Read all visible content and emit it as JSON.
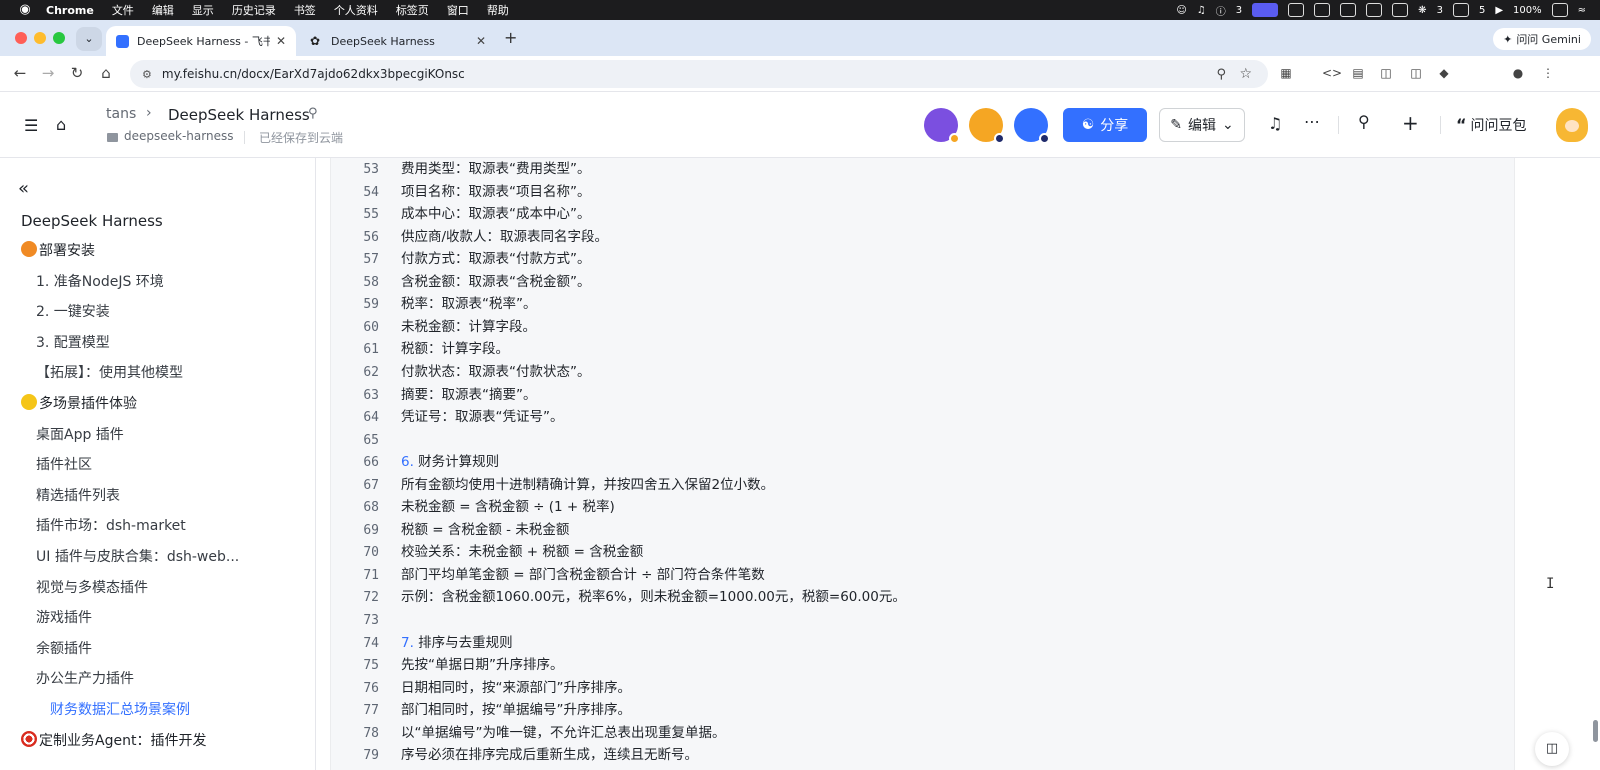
{
  "menubar": {
    "app": "Chrome",
    "items": [
      "文件",
      "编辑",
      "显示",
      "历史记录",
      "书签",
      "个人资料",
      "标签页",
      "窗口",
      "帮助"
    ],
    "status": {
      "notif_count": "3",
      "wechat_count": "3",
      "count5": "5",
      "battery": "100%"
    }
  },
  "browser": {
    "tabs": [
      {
        "title": "DeepSeek Harness - 飞书云文",
        "favicon": "feishu-doc-icon"
      },
      {
        "title": "DeepSeek Harness",
        "favicon": "deepseek-whale-icon"
      }
    ],
    "gemini_label": "问问 Gemini",
    "url": "my.feishu.cn/docx/EarXd7ajdo62dkx3bpecgiKOnsc"
  },
  "header": {
    "breadcrumb_parent": "tans",
    "breadcrumb_current": "DeepSeek Harness",
    "folder": "deepseek-harness",
    "saved_status": "已经保存到云端",
    "share_label": "分享",
    "edit_label": "编辑",
    "ask_label": "问问豆包",
    "colors": {
      "accent": "#3370ff"
    }
  },
  "sidebar": {
    "doc_title": "DeepSeek Harness",
    "items": [
      {
        "label": "部署安装",
        "level": 1,
        "emoji": "pumpkin"
      },
      {
        "label": "1. 准备NodeJS 环境",
        "level": 2
      },
      {
        "label": "2. 一键安装",
        "level": 2
      },
      {
        "label": "3. 配置模型",
        "level": 2
      },
      {
        "label": "【拓展】：使用其他模型",
        "level": 2
      },
      {
        "label": "多场景插件体验",
        "level": 1,
        "emoji": "smile"
      },
      {
        "label": "桌面App 插件",
        "level": 2
      },
      {
        "label": "插件社区",
        "level": 2
      },
      {
        "label": "精选插件列表",
        "level": 2
      },
      {
        "label": "插件市场：dsh-market",
        "level": 2
      },
      {
        "label": "UI 插件与皮肤合集：dsh-web...",
        "level": 2
      },
      {
        "label": "视觉与多模态插件",
        "level": 2
      },
      {
        "label": "游戏插件",
        "level": 2
      },
      {
        "label": "余额插件",
        "level": 2
      },
      {
        "label": "办公生产力插件",
        "level": 2
      },
      {
        "label": "财务数据汇总场景案例",
        "level": 3,
        "active": true
      },
      {
        "label": "定制业务Agent：插件开发",
        "level": 1,
        "emoji": "target"
      }
    ]
  },
  "code": {
    "lines": [
      {
        "n": "53",
        "text": "费用类型：取源表“费用类型”。"
      },
      {
        "n": "54",
        "text": "项目名称：取源表“项目名称”。"
      },
      {
        "n": "55",
        "text": "成本中心：取源表“成本中心”。"
      },
      {
        "n": "56",
        "text": "供应商/收款人：取源表同名字段。"
      },
      {
        "n": "57",
        "text": "付款方式：取源表“付款方式”。"
      },
      {
        "n": "58",
        "text": "含税金额：取源表“含税金额”。"
      },
      {
        "n": "59",
        "text": "税率：取源表“税率”。"
      },
      {
        "n": "60",
        "text": "未税金额：计算字段。"
      },
      {
        "n": "61",
        "text": "税额：计算字段。"
      },
      {
        "n": "62",
        "text": "付款状态：取源表“付款状态”。"
      },
      {
        "n": "63",
        "text": "摘要：取源表“摘要”。"
      },
      {
        "n": "64",
        "text": "凭证号：取源表“凭证号”。"
      },
      {
        "n": "65",
        "text": ""
      },
      {
        "n": "66",
        "num": "6.",
        "text": " 财务计算规则"
      },
      {
        "n": "67",
        "text": "所有金额均使用十进制精确计算，并按四舍五入保留2位小数。"
      },
      {
        "n": "68",
        "text": "未税金额 = 含税金额 ÷ (1 + 税率)"
      },
      {
        "n": "69",
        "text": "税额 = 含税金额 - 未税金额"
      },
      {
        "n": "70",
        "text": "校验关系：未税金额 + 税额 = 含税金额"
      },
      {
        "n": "71",
        "text": "部门平均单笔金额 = 部门含税金额合计 ÷ 部门符合条件笔数"
      },
      {
        "n": "72",
        "text": "示例：含税金额1060.00元，税率6%，则未税金额=1000.00元，税额=60.00元。"
      },
      {
        "n": "73",
        "text": ""
      },
      {
        "n": "74",
        "num": "7.",
        "text": " 排序与去重规则"
      },
      {
        "n": "75",
        "text": "先按“单据日期”升序排序。"
      },
      {
        "n": "76",
        "text": "日期相同时，按“来源部门”升序排序。"
      },
      {
        "n": "77",
        "text": "部门相同时，按“单据编号”升序排序。"
      },
      {
        "n": "78",
        "text": "以“单据编号”为唯一键，不允许汇总表出现重复单据。"
      },
      {
        "n": "79",
        "text": "序号必须在排序完成后重新生成，连续且无断号。"
      }
    ]
  }
}
